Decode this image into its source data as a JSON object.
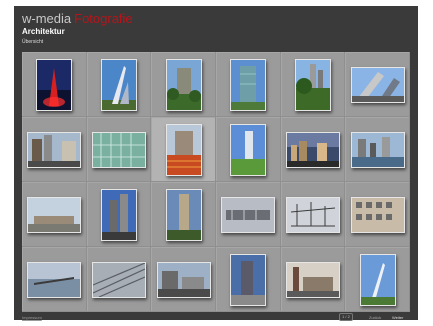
{
  "header": {
    "brand_white": "w-media",
    "brand_red": "Fotografie",
    "title": "Architektur",
    "subtitle": "Übersicht"
  },
  "gallery": {
    "thumbnails": [
      {
        "name": "thumbnail-red-sculpture",
        "scene": "red-night"
      },
      {
        "name": "thumbnail-tall-spire",
        "scene": "spire-sky"
      },
      {
        "name": "thumbnail-building-garden",
        "scene": "tower-trees"
      },
      {
        "name": "thumbnail-glass-tower",
        "scene": "tower-blue"
      },
      {
        "name": "thumbnail-towers-park",
        "scene": "trees-towers"
      },
      {
        "name": "thumbnail-tilted-blocks",
        "scene": "tilt-blocks"
      },
      {
        "name": "thumbnail-street-towers",
        "scene": "street-towers"
      },
      {
        "name": "thumbnail-green-facade",
        "scene": "green-facade"
      },
      {
        "name": "thumbnail-construction-site",
        "scene": "construction"
      },
      {
        "name": "thumbnail-tower-lawn",
        "scene": "lawn-tower"
      },
      {
        "name": "thumbnail-city-dusk",
        "scene": "city-dusk"
      },
      {
        "name": "thumbnail-harbour-city",
        "scene": "harbour"
      },
      {
        "name": "thumbnail-flat-building",
        "scene": "flat-sky"
      },
      {
        "name": "thumbnail-twin-towers",
        "scene": "twin-towers"
      },
      {
        "name": "thumbnail-skyscraper-trees",
        "scene": "sky-tower"
      },
      {
        "name": "thumbnail-bridge-structure",
        "scene": "bridge-grey"
      },
      {
        "name": "thumbnail-roof-construction",
        "scene": "roof-frame"
      },
      {
        "name": "thumbnail-facade-grid",
        "scene": "facade-grid"
      },
      {
        "name": "thumbnail-pier",
        "scene": "pier"
      },
      {
        "name": "thumbnail-rooftop-detail",
        "scene": "rooftop"
      },
      {
        "name": "thumbnail-street-corner",
        "scene": "street-corner"
      },
      {
        "name": "thumbnail-tower-plaza",
        "scene": "tower-plaza"
      },
      {
        "name": "thumbnail-chimney-building",
        "scene": "chimney"
      },
      {
        "name": "thumbnail-antenna",
        "scene": "antenna"
      }
    ]
  },
  "footer": {
    "left_link": "Impressum",
    "page_indicator": "1 / 2",
    "prev_label": "Zurück",
    "next_label": "Weiter"
  },
  "colors": {
    "background": "#3a3a3a",
    "panel": "#9b9b9b",
    "accent_red": "#b8141a"
  }
}
